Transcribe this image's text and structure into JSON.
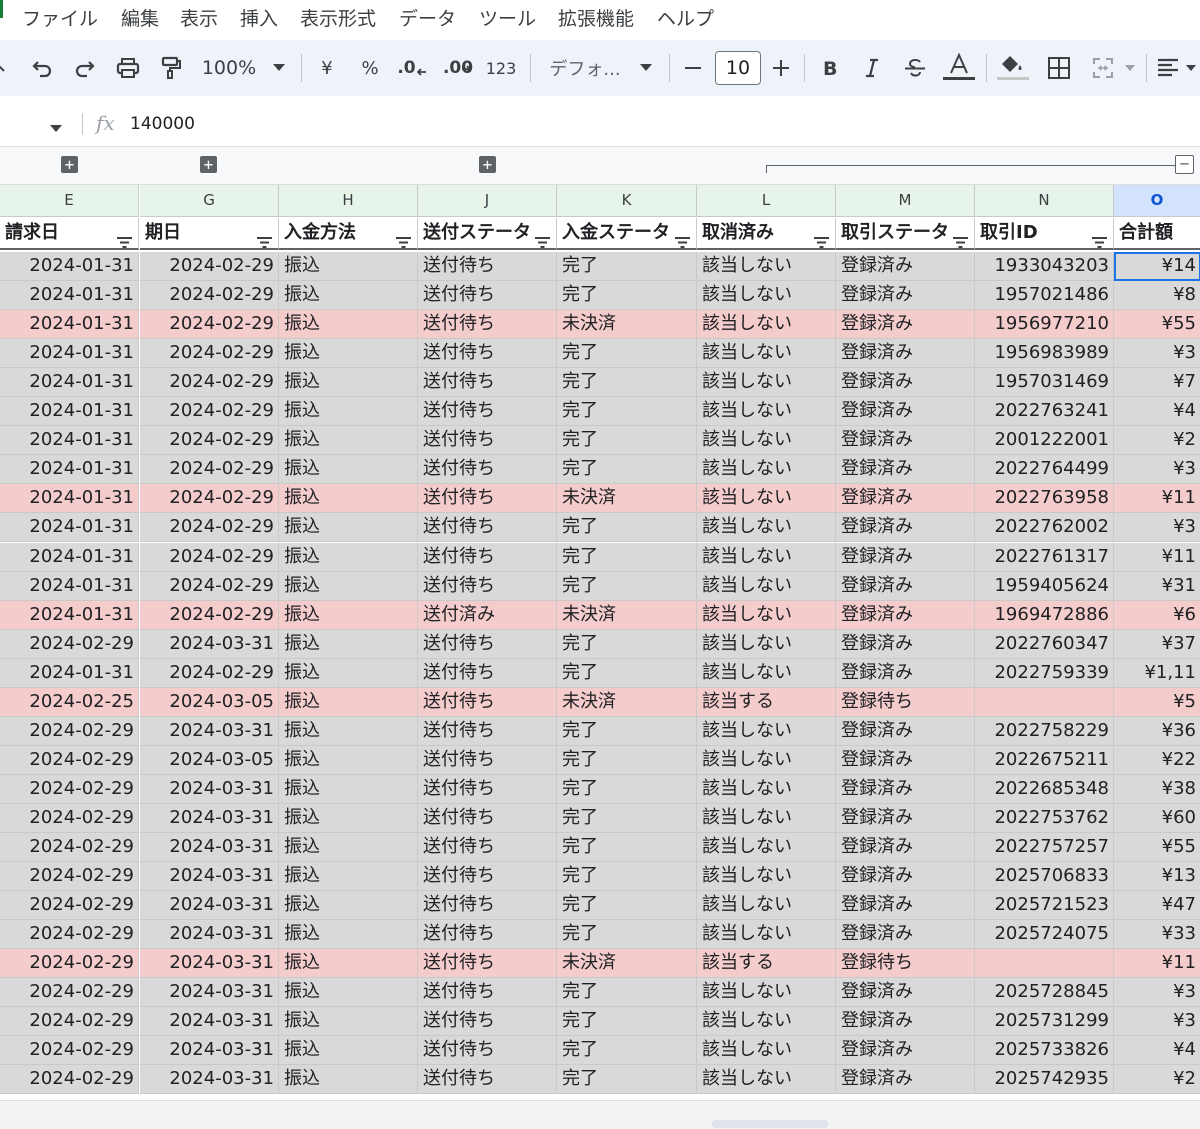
{
  "menu": [
    "ファイル",
    "編集",
    "表示",
    "挿入",
    "表示形式",
    "データ",
    "ツール",
    "拡張機能",
    "ヘルプ"
  ],
  "toolbar": {
    "zoom": "100%",
    "currency": "¥",
    "percent": "%",
    "decimal_decrease": ".0",
    "decimal_increase": ".00",
    "number_format": "123",
    "font": "デフォ...",
    "font_size": "10"
  },
  "formula_bar": {
    "value": "140000"
  },
  "columns": [
    {
      "letter": "E",
      "header": "請求日"
    },
    {
      "letter": "G",
      "header": "期日"
    },
    {
      "letter": "H",
      "header": "入金方法"
    },
    {
      "letter": "J",
      "header": "送付ステータ"
    },
    {
      "letter": "K",
      "header": "入金ステータ"
    },
    {
      "letter": "L",
      "header": "取消済み"
    },
    {
      "letter": "M",
      "header": "取引ステータ"
    },
    {
      "letter": "N",
      "header": "取引ID"
    },
    {
      "letter": "O",
      "header": "合計額"
    }
  ],
  "selected_column": "O",
  "colors": {
    "row_normal": "#d9d9d9",
    "row_highlight": "#f4cccc",
    "header_band": "#e6f4ea",
    "accent": "#1a73e8"
  },
  "rows": [
    {
      "e": "2024-01-31",
      "g": "2024-02-29",
      "h": "振込",
      "j": "送付待ち",
      "k": "完了",
      "l": "該当しない",
      "m": "登録済み",
      "n": "1933043203",
      "o": "¥14",
      "hl": false,
      "sel": true
    },
    {
      "e": "2024-01-31",
      "g": "2024-02-29",
      "h": "振込",
      "j": "送付待ち",
      "k": "完了",
      "l": "該当しない",
      "m": "登録済み",
      "n": "1957021486",
      "o": "¥8",
      "hl": false
    },
    {
      "e": "2024-01-31",
      "g": "2024-02-29",
      "h": "振込",
      "j": "送付待ち",
      "k": "未決済",
      "l": "該当しない",
      "m": "登録済み",
      "n": "1956977210",
      "o": "¥55",
      "hl": true
    },
    {
      "e": "2024-01-31",
      "g": "2024-02-29",
      "h": "振込",
      "j": "送付待ち",
      "k": "完了",
      "l": "該当しない",
      "m": "登録済み",
      "n": "1956983989",
      "o": "¥3",
      "hl": false
    },
    {
      "e": "2024-01-31",
      "g": "2024-02-29",
      "h": "振込",
      "j": "送付待ち",
      "k": "完了",
      "l": "該当しない",
      "m": "登録済み",
      "n": "1957031469",
      "o": "¥7",
      "hl": false
    },
    {
      "e": "2024-01-31",
      "g": "2024-02-29",
      "h": "振込",
      "j": "送付待ち",
      "k": "完了",
      "l": "該当しない",
      "m": "登録済み",
      "n": "2022763241",
      "o": "¥4",
      "hl": false
    },
    {
      "e": "2024-01-31",
      "g": "2024-02-29",
      "h": "振込",
      "j": "送付待ち",
      "k": "完了",
      "l": "該当しない",
      "m": "登録済み",
      "n": "2001222001",
      "o": "¥2",
      "hl": false
    },
    {
      "e": "2024-01-31",
      "g": "2024-02-29",
      "h": "振込",
      "j": "送付待ち",
      "k": "完了",
      "l": "該当しない",
      "m": "登録済み",
      "n": "2022764499",
      "o": "¥3",
      "hl": false
    },
    {
      "e": "2024-01-31",
      "g": "2024-02-29",
      "h": "振込",
      "j": "送付待ち",
      "k": "未決済",
      "l": "該当しない",
      "m": "登録済み",
      "n": "2022763958",
      "o": "¥11",
      "hl": true
    },
    {
      "e": "2024-01-31",
      "g": "2024-02-29",
      "h": "振込",
      "j": "送付待ち",
      "k": "完了",
      "l": "該当しない",
      "m": "登録済み",
      "n": "2022762002",
      "o": "¥3",
      "hl": false
    },
    {
      "e": "2024-01-31",
      "g": "2024-02-29",
      "h": "振込",
      "j": "送付待ち",
      "k": "完了",
      "l": "該当しない",
      "m": "登録済み",
      "n": "2022761317",
      "o": "¥11",
      "hl": false
    },
    {
      "e": "2024-01-31",
      "g": "2024-02-29",
      "h": "振込",
      "j": "送付待ち",
      "k": "完了",
      "l": "該当しない",
      "m": "登録済み",
      "n": "1959405624",
      "o": "¥31",
      "hl": false
    },
    {
      "e": "2024-01-31",
      "g": "2024-02-29",
      "h": "振込",
      "j": "送付済み",
      "k": "未決済",
      "l": "該当しない",
      "m": "登録済み",
      "n": "1969472886",
      "o": "¥6",
      "hl": true
    },
    {
      "e": "2024-02-29",
      "g": "2024-03-31",
      "h": "振込",
      "j": "送付待ち",
      "k": "完了",
      "l": "該当しない",
      "m": "登録済み",
      "n": "2022760347",
      "o": "¥37",
      "hl": false
    },
    {
      "e": "2024-01-31",
      "g": "2024-02-29",
      "h": "振込",
      "j": "送付待ち",
      "k": "完了",
      "l": "該当しない",
      "m": "登録済み",
      "n": "2022759339",
      "o": "¥1,11",
      "hl": false
    },
    {
      "e": "2024-02-25",
      "g": "2024-03-05",
      "h": "振込",
      "j": "送付待ち",
      "k": "未決済",
      "l": "該当する",
      "m": "登録待ち",
      "n": "",
      "o": "¥5",
      "hl": true
    },
    {
      "e": "2024-02-29",
      "g": "2024-03-31",
      "h": "振込",
      "j": "送付待ち",
      "k": "完了",
      "l": "該当しない",
      "m": "登録済み",
      "n": "2022758229",
      "o": "¥36",
      "hl": false
    },
    {
      "e": "2024-02-29",
      "g": "2024-03-05",
      "h": "振込",
      "j": "送付待ち",
      "k": "完了",
      "l": "該当しない",
      "m": "登録済み",
      "n": "2022675211",
      "o": "¥22",
      "hl": false
    },
    {
      "e": "2024-02-29",
      "g": "2024-03-31",
      "h": "振込",
      "j": "送付待ち",
      "k": "完了",
      "l": "該当しない",
      "m": "登録済み",
      "n": "2022685348",
      "o": "¥38",
      "hl": false
    },
    {
      "e": "2024-02-29",
      "g": "2024-03-31",
      "h": "振込",
      "j": "送付待ち",
      "k": "完了",
      "l": "該当しない",
      "m": "登録済み",
      "n": "2022753762",
      "o": "¥60",
      "hl": false
    },
    {
      "e": "2024-02-29",
      "g": "2024-03-31",
      "h": "振込",
      "j": "送付待ち",
      "k": "完了",
      "l": "該当しない",
      "m": "登録済み",
      "n": "2022757257",
      "o": "¥55",
      "hl": false
    },
    {
      "e": "2024-02-29",
      "g": "2024-03-31",
      "h": "振込",
      "j": "送付待ち",
      "k": "完了",
      "l": "該当しない",
      "m": "登録済み",
      "n": "2025706833",
      "o": "¥13",
      "hl": false
    },
    {
      "e": "2024-02-29",
      "g": "2024-03-31",
      "h": "振込",
      "j": "送付待ち",
      "k": "完了",
      "l": "該当しない",
      "m": "登録済み",
      "n": "2025721523",
      "o": "¥47",
      "hl": false
    },
    {
      "e": "2024-02-29",
      "g": "2024-03-31",
      "h": "振込",
      "j": "送付待ち",
      "k": "完了",
      "l": "該当しない",
      "m": "登録済み",
      "n": "2025724075",
      "o": "¥33",
      "hl": false
    },
    {
      "e": "2024-02-29",
      "g": "2024-03-31",
      "h": "振込",
      "j": "送付待ち",
      "k": "未決済",
      "l": "該当する",
      "m": "登録待ち",
      "n": "",
      "o": "¥11",
      "hl": true
    },
    {
      "e": "2024-02-29",
      "g": "2024-03-31",
      "h": "振込",
      "j": "送付待ち",
      "k": "完了",
      "l": "該当しない",
      "m": "登録済み",
      "n": "2025728845",
      "o": "¥3",
      "hl": false
    },
    {
      "e": "2024-02-29",
      "g": "2024-03-31",
      "h": "振込",
      "j": "送付待ち",
      "k": "完了",
      "l": "該当しない",
      "m": "登録済み",
      "n": "2025731299",
      "o": "¥3",
      "hl": false
    },
    {
      "e": "2024-02-29",
      "g": "2024-03-31",
      "h": "振込",
      "j": "送付待ち",
      "k": "完了",
      "l": "該当しない",
      "m": "登録済み",
      "n": "2025733826",
      "o": "¥4",
      "hl": false
    },
    {
      "e": "2024-02-29",
      "g": "2024-03-31",
      "h": "振込",
      "j": "送付待ち",
      "k": "完了",
      "l": "該当しない",
      "m": "登録済み",
      "n": "2025742935",
      "o": "¥2",
      "hl": false
    }
  ]
}
